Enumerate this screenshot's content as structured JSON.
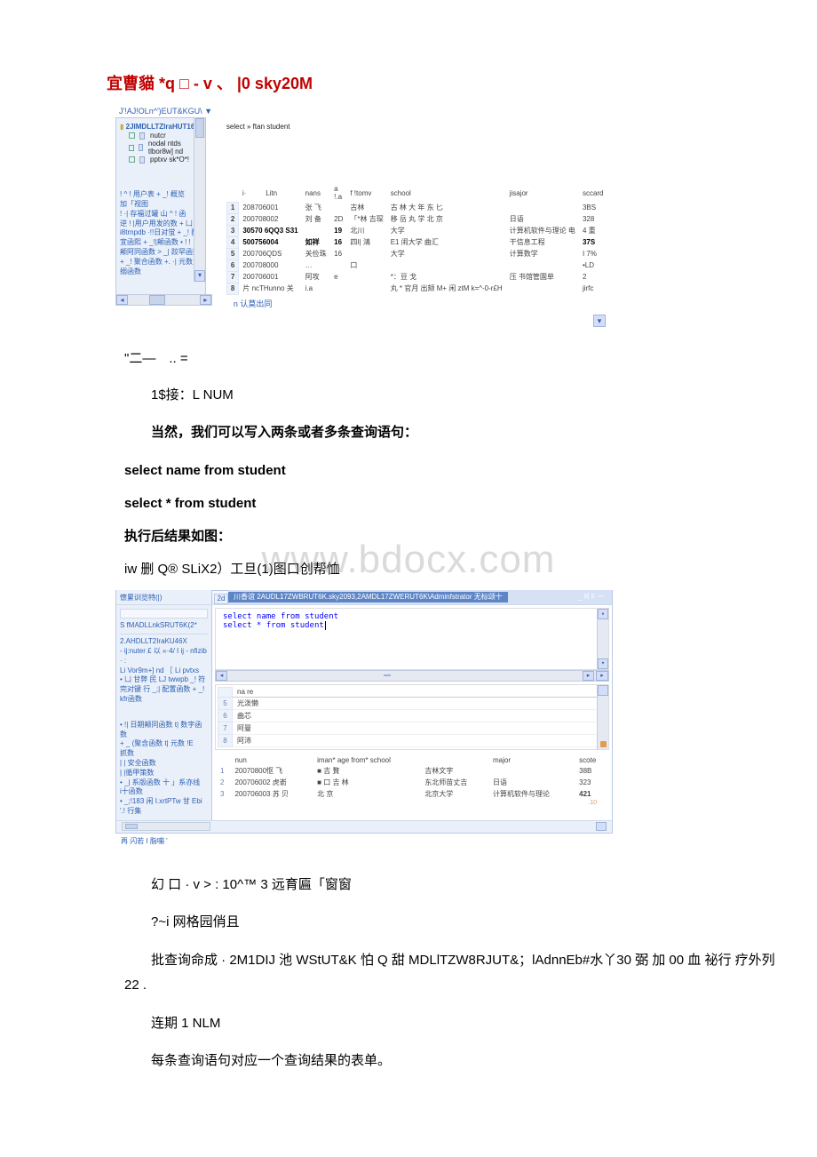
{
  "title": "宜曹貓 *q □ - v 、 |0 sky20M",
  "shot1": {
    "header": "J'!AJ!OLn^')EUT&KGU\\   ▼",
    "tree_root": "2JlMDLLTZlraHUT16K",
    "tree_nodes": [
      "nutcr",
      "nodal ntds tlbor8w] nd",
      "pptxv sk*O*!"
    ],
    "tree_block2_lines": [
      "! ^ ! 用户表 + _! 概览",
      "加「视图",
      "!  ·| 存福过罐 山 ^ ! 函",
      "逆 !  |用户用发的数 + 凵",
      "i8trnpdb ·!!日对蛍 + _! 配",
      "宜函熙 + _!|颠函数 • ! ! 日",
      "颠阿同函数 > _| 跤罕函数",
      "+ _! 聚合函数 +. ·|  元数",
      "搦函数"
    ],
    "sql": "select » ftan student",
    "table_headers": [
      "i·",
      "Litn",
      "nans",
      "a !.a",
      "f !tomv",
      "school",
      "jisajor",
      "sccard"
    ],
    "rows": [
      {
        "n": "1",
        "num": "208706001",
        "name": "张 飞",
        "age": "",
        "from": "古林",
        "school": "古 林 大 年  东 匕",
        "major": "",
        "score": "3BS"
      },
      {
        "n": "2",
        "num": "200708002",
        "name": "刘 备",
        "age": "2D",
        "from": "「*林\n吉琛",
        "school": "移 岳 丸 学  北 京",
        "major": "日语",
        "score": "328"
      },
      {
        "n": "3",
        "numb": "30570 6QQ3 S31",
        "nameb": "",
        "age": "19",
        "from": "北川",
        "school": "大学",
        "major": "计算机软件与理论 电",
        "score": "4 重"
      },
      {
        "n": "4",
        "numb": "500756004",
        "nameb": "如祥",
        "age": "16",
        "from": "四I|\n鴻",
        "school": "E1 闹大学  曲汇",
        "major": "干信息工程",
        "score": "37S"
      },
      {
        "n": "5",
        "num": "200706QDS",
        "name": "关俭珠",
        "age": "16",
        "from": "",
        "school": "大学",
        "major": "计算数学",
        "score": "I  7%"
      },
      {
        "n": "6",
        "num": "200708000",
        "name": "…",
        "age": "",
        "from": "口",
        "school": "",
        "major": "",
        "score": "•LD"
      },
      {
        "n": "7",
        "num": "200706001",
        "name": "阿攻",
        "age": "e",
        "from": "",
        "school": "*：豆 戈",
        "major": "压 书馆管園单",
        "score": "2"
      },
      {
        "n": "8",
        "num": "片 ncTHunno 关",
        "name": " i.a",
        "age": "",
        "from": "",
        "school": "丸 * 官月 出颏 M+  闲  ztM k=^-0-r£H",
        "major": "",
        "score": "jirfc"
      }
    ],
    "status": "n 认莫出同"
  },
  "watermark": "www.bdocx.com",
  "doc_lines": {
    "l1": "\"二—　.. =",
    "l2": "1$接：L NUM",
    "l3": "当然，我们可以写入两条或者多条查询语句：",
    "sql1": "select name from student",
    "sql2": "select * from student",
    "l4": "执行后结果如图：",
    "l5": "iw 删 Q® SLiX2）工旦(1)图口创帮恤"
  },
  "shot2": {
    "sidebar_title": "懷累训览特(|)",
    "sidebar_root": "S fMADLLnkSRUT6K(2*",
    "sidebar_root2": "2.AHDLLT2IraKU46X",
    "sidebar_lines1": [
      "- ij:nuter £ 以 «·4/ I ij - nfizib · :",
      "Li Vor9m+] nd ［ Li pvtxs",
      "• 凵 甘弊 民 LJ twwpb _! 符",
      "完对键 行 _;| 配置函数 + _!",
      "kfr函数"
    ],
    "sidebar_lines2": [
      "• !| 日期颠同函数 t| 数字函",
      "数",
      "+ _ (聚含函数 t| 元数 !E",
      "抓数",
      " |  | 安全函数",
      "  |  |循甲策数",
      "• _| 系版函数 十 」系亦线",
      "i十函数",
      "• _;!183 闲 I.xrtPTw 甘 Ebi",
      "'.! 行集"
    ],
    "tab_num": "2d",
    "tab_title": "川香谊 2AUDL17ZWBRUT6K.sky2093,2AMDL17ZWERUT6K\\Adminfstrator 无标颂十",
    "tab_right": "_ R F 一",
    "sql_lines": [
      "select name from student",
      "select * from student"
    ],
    "grid1_header": "na re",
    "grid1_rows": [
      {
        "n": "5",
        "v": "光泼懒"
      },
      {
        "n": "6",
        "v": "曲芯"
      },
      {
        "n": "7",
        "v": "阿曼"
      },
      {
        "n": "8",
        "v": "阿沛"
      }
    ],
    "grid2_headers": [
      "",
      "nun",
      "iman* age from* school",
      "",
      "major",
      "scote"
    ],
    "grid2_rows": [
      {
        "n": "1",
        "num": "20070800怄 飞",
        "ic": "■",
        "from": "吉 贅",
        "school": "吉林文字",
        "major": "",
        "score": "38B"
      },
      {
        "n": "2",
        "num": "200706002 虎嵛",
        "ic": "■\n口",
        "from": "吉 林",
        "school": "东北师苗丈吉",
        "major": "日语",
        "score": "323"
      },
      {
        "n": "3",
        "num": "200706003 苏 贝",
        "ic": "",
        "from": "北  京",
        "school": "北京大学",
        "major": "计算机软件与理论",
        "score": "421"
      }
    ],
    "bottom_right_num": ".10",
    "caption": "再 闪若 I 脂嘣 '"
  },
  "tail": {
    "t1": "幻 口 · v > : 10^™ 3 远育匾「窗窗",
    "t2": "?~i 网格园俏且",
    "t3": "批查询命成 · 2M1DIJ 池 WStUT&K 怕 Q 甜 MDLlTZW8RJUT&；lAdnnEb#水丫30 弼 加 00 血 祕行 疗外列 22 .",
    "t4": "连期 1 NLM",
    "t5": "每条查询语句对应一个查询结果的表单。"
  }
}
